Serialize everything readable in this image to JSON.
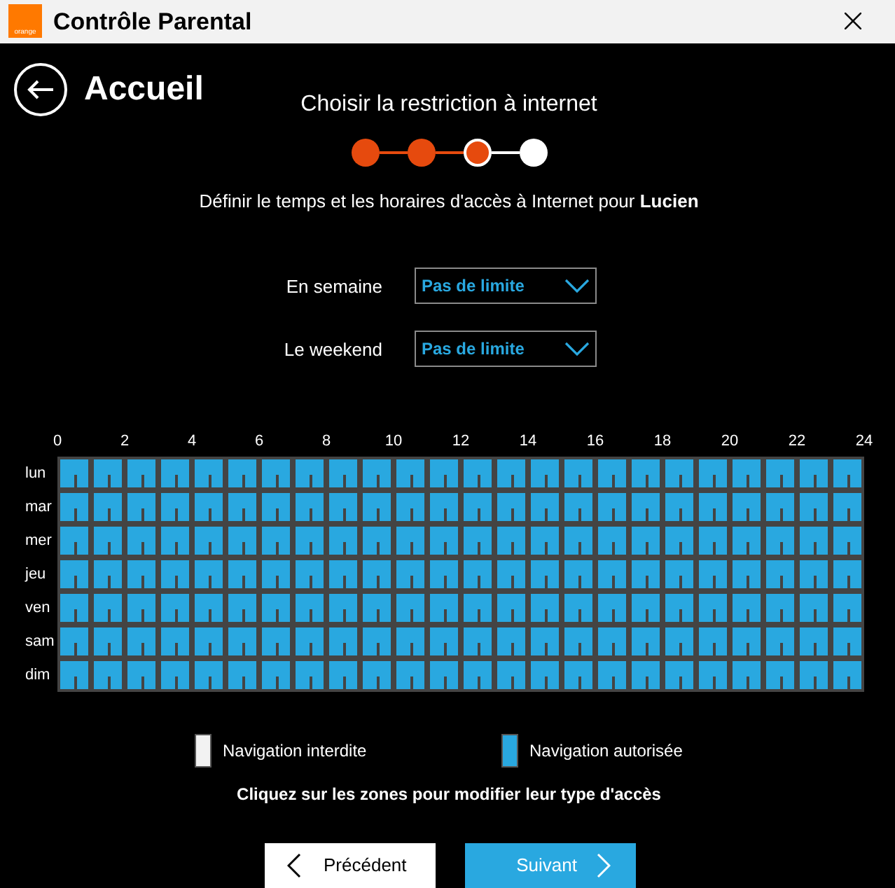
{
  "window": {
    "title": "Contrôle Parental",
    "logo": "orange"
  },
  "header": {
    "back_label": "Accueil",
    "step_title": "Choisir la restriction à internet"
  },
  "steps": [
    {
      "done": true,
      "selected": false
    },
    {
      "done": true,
      "selected": false
    },
    {
      "done": true,
      "selected": true
    },
    {
      "done": false,
      "selected": false
    }
  ],
  "description": "Définir le temps et les horaires d'accès à Internet pour **Lucien**",
  "limits": [
    {
      "label": "En semaine",
      "value": "Pas de limite"
    },
    {
      "label": "Le weekend",
      "value": "Pas de limite"
    }
  ],
  "grid": {
    "hour_labels": [
      "0",
      "2",
      "4",
      "6",
      "8",
      "10",
      "12",
      "14",
      "16",
      "18",
      "20",
      "22",
      "24"
    ],
    "rows": [
      {
        "day": "lun",
        "slots": [
          true,
          true,
          true,
          true,
          true,
          true,
          true,
          true,
          true,
          true,
          true,
          true,
          true,
          true,
          true,
          true,
          true,
          true,
          true,
          true,
          true,
          true,
          true,
          true
        ]
      },
      {
        "day": "mar",
        "slots": [
          true,
          true,
          true,
          true,
          true,
          true,
          true,
          true,
          true,
          true,
          true,
          true,
          true,
          true,
          true,
          true,
          true,
          true,
          true,
          true,
          true,
          true,
          true,
          true
        ]
      },
      {
        "day": "mer",
        "slots": [
          true,
          true,
          true,
          true,
          true,
          true,
          true,
          true,
          true,
          true,
          true,
          true,
          true,
          true,
          true,
          true,
          true,
          true,
          true,
          true,
          true,
          true,
          true,
          true
        ]
      },
      {
        "day": "jeu",
        "slots": [
          true,
          true,
          true,
          true,
          true,
          true,
          true,
          true,
          true,
          true,
          true,
          true,
          true,
          true,
          true,
          true,
          true,
          true,
          true,
          true,
          true,
          true,
          true,
          true
        ]
      },
      {
        "day": "ven",
        "slots": [
          true,
          true,
          true,
          true,
          true,
          true,
          true,
          true,
          true,
          true,
          true,
          true,
          true,
          true,
          true,
          true,
          true,
          true,
          true,
          true,
          true,
          true,
          true,
          true
        ]
      },
      {
        "day": "sam",
        "slots": [
          true,
          true,
          true,
          true,
          true,
          true,
          true,
          true,
          true,
          true,
          true,
          true,
          true,
          true,
          true,
          true,
          true,
          true,
          true,
          true,
          true,
          true,
          true,
          true
        ]
      },
      {
        "day": "dim",
        "slots": [
          true,
          true,
          true,
          true,
          true,
          true,
          true,
          true,
          true,
          true,
          true,
          true,
          true,
          true,
          true,
          true,
          true,
          true,
          true,
          true,
          true,
          true,
          true,
          true
        ]
      }
    ]
  },
  "legend": [
    {
      "label": "Navigation interdite",
      "allowed": false
    },
    {
      "label": "Navigation autorisée",
      "allowed": true
    }
  ],
  "hint": "Cliquez sur les zones pour modifier leur type d'accès",
  "buttons": [
    {
      "label": "Précédent",
      "kind": "back"
    },
    {
      "label": "Suivant",
      "kind": "next"
    }
  ]
}
